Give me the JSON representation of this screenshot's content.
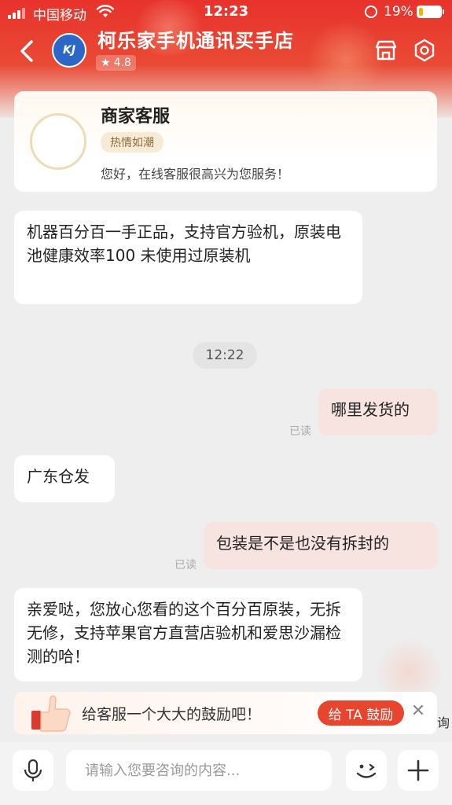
{
  "status_bar": {
    "carrier": "中国移动",
    "time": "12:23",
    "battery_percent": "19%",
    "battery_level": 0.19,
    "icons": [
      "signal-icon",
      "wifi-icon",
      "rotation-lock-icon",
      "battery-icon"
    ]
  },
  "header": {
    "shop_name": "柯乐家手机通讯买手店",
    "rating": "4.8",
    "logo_text": "KJ",
    "icons": [
      "back-icon",
      "store-icon",
      "settings-icon",
      "star-icon"
    ]
  },
  "service_card": {
    "title": "商家客服",
    "badge": "热情如潮",
    "greeting": "您好，在线客服很高兴为您服务！"
  },
  "messages": [
    {
      "from": "merchant",
      "text": "机器百分百一手正品，支持官方验机，原装电池健康效率100 未使用过原装机"
    },
    {
      "type": "time",
      "text": "12:22"
    },
    {
      "from": "user",
      "text": "哪里发货的",
      "status": "已读"
    },
    {
      "from": "merchant",
      "text": "广东仓发"
    },
    {
      "from": "user",
      "text": "包装是不是也没有拆封的",
      "status": "已读"
    },
    {
      "from": "merchant",
      "text": "亲爱哒，您放心您看的这个百分百原装，无拆无修，支持苹果官方直营店验机和爱思沙漏检测的哈！"
    }
  ],
  "encourage_bar": {
    "text": "给客服一个大大的鼓励吧！",
    "button": "给 TA 鼓励",
    "clipped_text": "询"
  },
  "input_bar": {
    "placeholder": "请输入您要咨询的内容...",
    "value": "",
    "icons": [
      "microphone-icon",
      "emoji-icon",
      "plus-icon"
    ]
  },
  "colors": {
    "brand_red": "#e8322c",
    "user_bubble": "#f7e3df",
    "button_red": "#e8452f"
  }
}
